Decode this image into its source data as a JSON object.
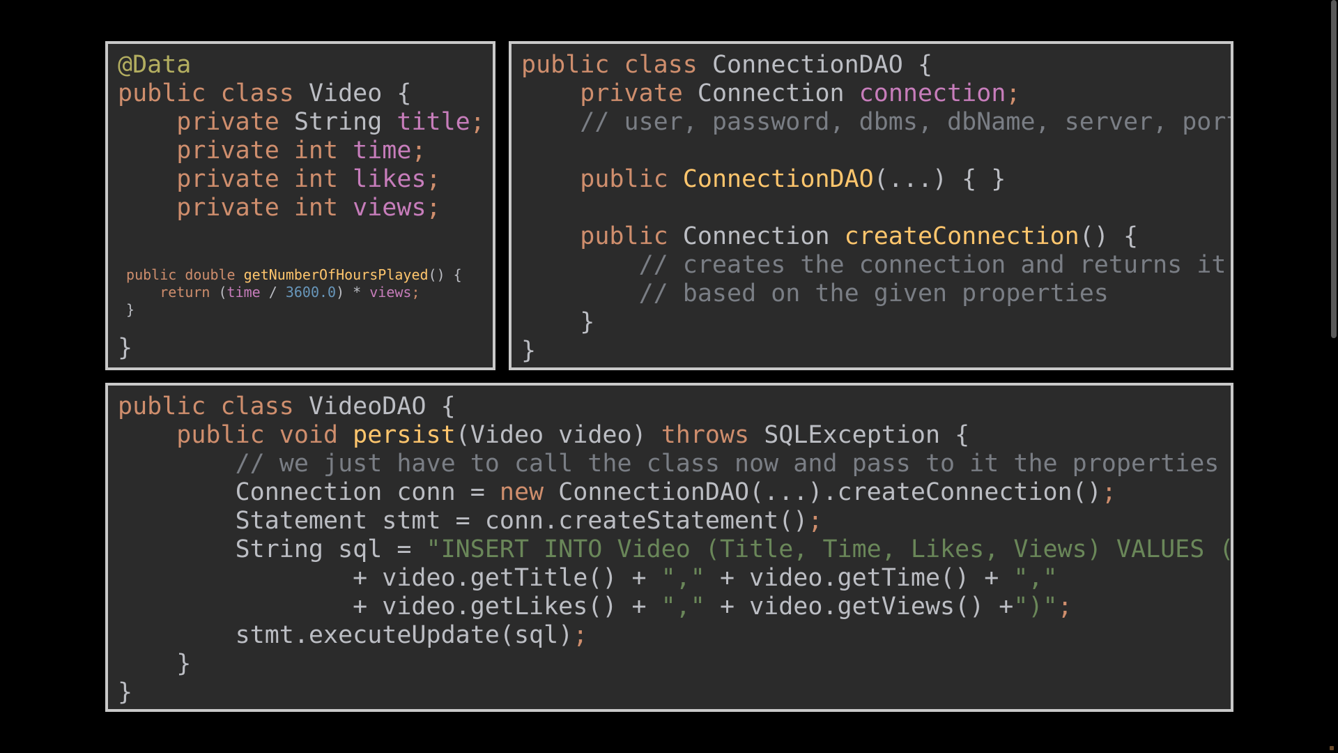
{
  "panels": {
    "video": [
      [
        {
          "t": "@Data",
          "c": "ann"
        }
      ],
      [
        {
          "t": "public class ",
          "c": "kw"
        },
        {
          "t": "Video {",
          "c": "id"
        }
      ],
      [
        {
          "t": "    private ",
          "c": "kw"
        },
        {
          "t": "String ",
          "c": "id"
        },
        {
          "t": "title",
          "c": "fld"
        },
        {
          "t": ";",
          "c": "kw"
        }
      ],
      [
        {
          "t": "    private int ",
          "c": "kw"
        },
        {
          "t": "time",
          "c": "fld"
        },
        {
          "t": ";",
          "c": "kw"
        }
      ],
      [
        {
          "t": "    private int ",
          "c": "kw"
        },
        {
          "t": "likes",
          "c": "fld"
        },
        {
          "t": ";",
          "c": "kw"
        }
      ],
      [
        {
          "t": "    private int ",
          "c": "kw"
        },
        {
          "t": "views",
          "c": "fld"
        },
        {
          "t": ";",
          "c": "kw"
        }
      ],
      "SPACER",
      "SPACER_SM",
      {
        "small": true,
        "tokens": [
          {
            "t": " public double ",
            "c": "kw"
          },
          {
            "t": "getNumberOfHoursPlayed",
            "c": "fn"
          },
          {
            "t": "() {",
            "c": "id"
          }
        ]
      },
      {
        "small": true,
        "tokens": [
          {
            "t": "     return ",
            "c": "kw"
          },
          {
            "t": "(",
            "c": "id"
          },
          {
            "t": "time",
            "c": "fld"
          },
          {
            "t": " / ",
            "c": "id"
          },
          {
            "t": "3600.0",
            "c": "num"
          },
          {
            "t": ") * ",
            "c": "id"
          },
          {
            "t": "views",
            "c": "fld"
          },
          {
            "t": ";",
            "c": "kw"
          }
        ]
      },
      {
        "small": true,
        "tokens": [
          {
            "t": " }",
            "c": "id"
          }
        ]
      },
      "SPACER_SM",
      [
        {
          "t": "}",
          "c": "id"
        }
      ]
    ],
    "connection": [
      [
        {
          "t": "public class ",
          "c": "kw"
        },
        {
          "t": "ConnectionDAO {",
          "c": "id"
        }
      ],
      [
        {
          "t": "    private ",
          "c": "kw"
        },
        {
          "t": "Connection ",
          "c": "id"
        },
        {
          "t": "connection",
          "c": "fld"
        },
        {
          "t": ";",
          "c": "kw"
        }
      ],
      [
        {
          "t": "    // user, password, dbms, dbName, server, port",
          "c": "cm"
        }
      ],
      "SPACER",
      [
        {
          "t": "    public ",
          "c": "kw"
        },
        {
          "t": "ConnectionDAO",
          "c": "fn"
        },
        {
          "t": "(...) { }",
          "c": "id"
        }
      ],
      "SPACER",
      [
        {
          "t": "    public ",
          "c": "kw"
        },
        {
          "t": "Connection ",
          "c": "id"
        },
        {
          "t": "createConnection",
          "c": "fn"
        },
        {
          "t": "() {",
          "c": "id"
        }
      ],
      [
        {
          "t": "        // creates the connection and returns it",
          "c": "cm"
        }
      ],
      [
        {
          "t": "        // based on the given properties",
          "c": "cm"
        }
      ],
      [
        {
          "t": "    }",
          "c": "id"
        }
      ],
      [
        {
          "t": "}",
          "c": "id"
        }
      ]
    ],
    "dao": [
      [
        {
          "t": "public class ",
          "c": "kw"
        },
        {
          "t": "VideoDAO {",
          "c": "id"
        }
      ],
      [
        {
          "t": "    public void ",
          "c": "kw"
        },
        {
          "t": "persist",
          "c": "fn"
        },
        {
          "t": "(Video video) ",
          "c": "id"
        },
        {
          "t": "throws ",
          "c": "kw"
        },
        {
          "t": "SQLException {",
          "c": "id"
        }
      ],
      [
        {
          "t": "        // we just have to call the class now and pass to it the properties",
          "c": "cm"
        }
      ],
      [
        {
          "t": "        Connection conn = ",
          "c": "id"
        },
        {
          "t": "new ",
          "c": "kw"
        },
        {
          "t": "ConnectionDAO(...).createConnection()",
          "c": "id"
        },
        {
          "t": ";",
          "c": "kw"
        }
      ],
      [
        {
          "t": "        Statement stmt = conn.createStatement()",
          "c": "id"
        },
        {
          "t": ";",
          "c": "kw"
        }
      ],
      [
        {
          "t": "        String sql = ",
          "c": "id"
        },
        {
          "t": "\"INSERT INTO Video (Title, Time, Likes, Views) VALUES (\"",
          "c": "str"
        }
      ],
      [
        {
          "t": "                + video.getTitle() + ",
          "c": "id"
        },
        {
          "t": "\",\"",
          "c": "str"
        },
        {
          "t": " + video.getTime() + ",
          "c": "id"
        },
        {
          "t": "\",\"",
          "c": "str"
        }
      ],
      [
        {
          "t": "                + video.getLikes() + ",
          "c": "id"
        },
        {
          "t": "\",\"",
          "c": "str"
        },
        {
          "t": " + video.getViews() +",
          "c": "id"
        },
        {
          "t": "\")\"",
          "c": "str"
        },
        {
          "t": ";",
          "c": "kw"
        }
      ],
      [
        {
          "t": "        stmt.executeUpdate(sql)",
          "c": "id"
        },
        {
          "t": ";",
          "c": "kw"
        }
      ],
      [
        {
          "t": "    }",
          "c": "id"
        }
      ],
      [
        {
          "t": "}",
          "c": "id"
        }
      ]
    ]
  },
  "colors": {
    "background": "#000000",
    "panel": "#2b2b2b",
    "border": "#c9c9c9",
    "keyword": "#cf8e6d",
    "annotation": "#b3ae60",
    "field": "#c77dbb",
    "function": "#ffc66d",
    "comment": "#7a7e85",
    "string": "#6a8759",
    "number": "#6897bb",
    "identifier": "#bcbec4"
  }
}
